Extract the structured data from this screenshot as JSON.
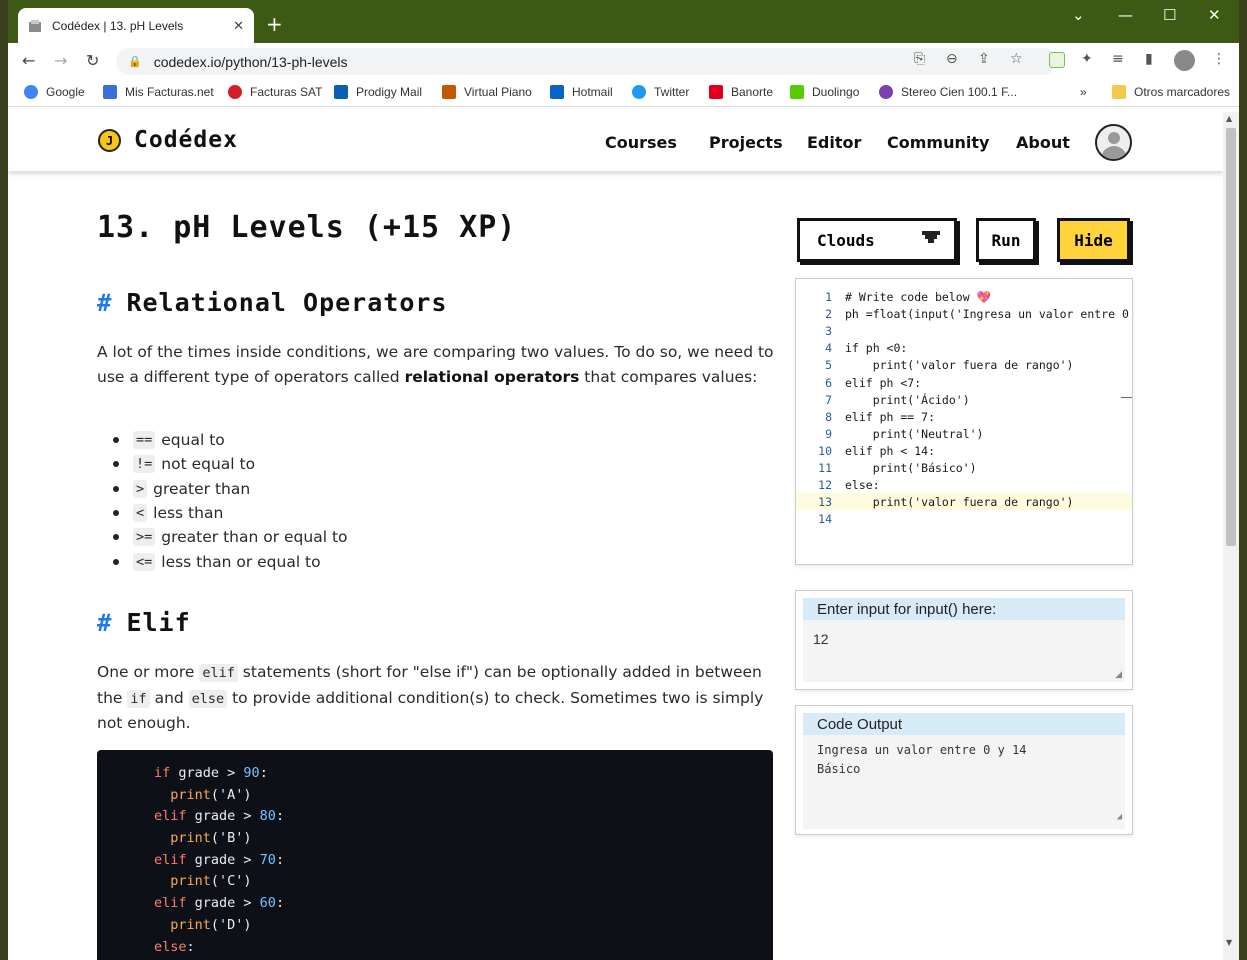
{
  "browser": {
    "tab_title": "Codédex | 13. pH Levels",
    "tab_close": "✕",
    "new_tab": "+",
    "url": "codedex.io/python/13-ph-levels",
    "bookmarks": [
      {
        "label": "Google",
        "color": "#4285f4"
      },
      {
        "label": "Mis Facturas.net",
        "color": "#3b6fd8"
      },
      {
        "label": "Facturas SAT",
        "color": "#d71e28"
      },
      {
        "label": "Prodigy Mail",
        "color": "#0a5fb4"
      },
      {
        "label": "Virtual Piano",
        "color": "#c05a00"
      },
      {
        "label": "Hotmail",
        "color": "#0a64c8"
      },
      {
        "label": "Twitter",
        "color": "#1d9bf0"
      },
      {
        "label": "Banorte",
        "color": "#e1001a"
      },
      {
        "label": "Duolingo",
        "color": "#58cc02"
      },
      {
        "label": "Stereo Cien 100.1 F...",
        "color": "#7b3fb0"
      }
    ],
    "bookmarks_overflow": "»",
    "other_bookmarks": "Otros marcadores"
  },
  "site": {
    "logo_coin": "J",
    "logo_text": "Codédex",
    "nav": [
      "Courses",
      "Projects",
      "Editor",
      "Community",
      "About"
    ]
  },
  "lesson": {
    "title": "13. pH Levels (+15 XP)",
    "section1_title": "Relational Operators",
    "section1_p_before": "A lot of the times inside conditions, we are comparing two values. To do so, we need to use a different type of operators called ",
    "section1_p_bold": "relational operators",
    "section1_p_after": " that compares values:",
    "operators": [
      {
        "op": "==",
        "desc": "equal to"
      },
      {
        "op": "!=",
        "desc": "not equal to"
      },
      {
        "op": ">",
        "desc": "greater than"
      },
      {
        "op": "<",
        "desc": "less than"
      },
      {
        "op": ">=",
        "desc": "greater than or equal to"
      },
      {
        "op": "<=",
        "desc": "less than or equal to"
      }
    ],
    "section2_title": "Elif",
    "section2_p1": "One or more ",
    "section2_code1": "elif",
    "section2_p2": " statements (short for \"else if\") can be optionally added in between the ",
    "section2_code2": "if",
    "section2_p3": " and ",
    "section2_code3": "else",
    "section2_p4": " to provide additional condition(s) to check. Sometimes two is simply not enough.",
    "example_code": [
      {
        "kw": "if",
        "rest": " grade > ",
        "num": "90",
        "end": ":"
      },
      {
        "indent": true,
        "fn": "print",
        "str": "('A')"
      },
      {
        "kw": "elif",
        "rest": " grade > ",
        "num": "80",
        "end": ":"
      },
      {
        "indent": true,
        "fn": "print",
        "str": "('B')"
      },
      {
        "kw": "elif",
        "rest": " grade > ",
        "num": "70",
        "end": ":"
      },
      {
        "indent": true,
        "fn": "print",
        "str": "('C')"
      },
      {
        "kw": "elif",
        "rest": " grade > ",
        "num": "60",
        "end": ":"
      },
      {
        "indent": true,
        "fn": "print",
        "str": "('D')"
      },
      {
        "kw": "else",
        "rest": "",
        "num": "",
        "end": ":"
      }
    ]
  },
  "editor_panel": {
    "theme_label": "Clouds",
    "run_label": "Run",
    "hide_label": "Hide",
    "hide_color": "#ffd43b",
    "code_lines": [
      "# Write code below 💖",
      "ph =float(input('Ingresa un valor entre 0",
      "",
      "if ph <0:",
      "    print('valor fuera de rango')",
      "elif ph <7:",
      "    print('Ácido')",
      "elif ph == 7:",
      "    print('Neutral')",
      "elif ph < 14:",
      "    print('Básico')",
      "else:",
      "    print('valor fuera de rango')",
      ""
    ],
    "input_label": "Enter input for input() here:",
    "input_value": "12",
    "output_label": "Code Output",
    "output_lines": [
      "Ingresa un valor entre 0 y 14",
      "Básico"
    ]
  }
}
